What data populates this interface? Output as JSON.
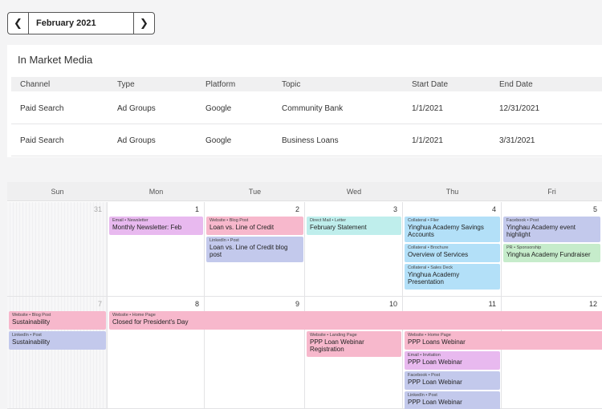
{
  "nav": {
    "prev_icon": "chevron-left-icon",
    "next_icon": "chevron-right-icon",
    "month_label": "February 2021"
  },
  "media": {
    "title": "In Market Media",
    "columns": [
      "Channel",
      "Type",
      "Platform",
      "Topic",
      "Start Date",
      "End Date"
    ],
    "rows": [
      [
        "Paid Search",
        "Ad Groups",
        "Google",
        "Community Bank",
        "1/1/2021",
        "12/31/2021"
      ],
      [
        "Paid Search",
        "Ad Groups",
        "Google",
        "Business Loans",
        "1/1/2021",
        "3/31/2021"
      ]
    ]
  },
  "calendar": {
    "weekdays": [
      "Sun",
      "Mon",
      "Tue",
      "Wed",
      "Thu",
      "Fri"
    ],
    "weeks": [
      [
        "31",
        "1",
        "2",
        "3",
        "4",
        "5"
      ],
      [
        "7",
        "8",
        "9",
        "10",
        "11",
        "12"
      ]
    ],
    "colors": {
      "pink": "#f7b8cc",
      "purple": "#e8b9ef",
      "periwinkle": "#c3c9ec",
      "cyan": "#bfeeec",
      "blue": "#b3e0f8",
      "green": "#c6eccb"
    },
    "events": [
      {
        "category": "Email • Newsletter",
        "title": "Monthly Newsletter: Feb"
      },
      {
        "category": "Website • Blog Post",
        "title": "Loan vs. Line of Credit"
      },
      {
        "category": "LinkedIn • Post",
        "title": "Loan vs. Line of Credit blog post"
      },
      {
        "category": "Direct Mail • Letter",
        "title": "February Statement"
      },
      {
        "category": "Collateral • Flier",
        "title": "Yinghua Academy Savings Accounts"
      },
      {
        "category": "Collateral • Brochure",
        "title": "Overview of Services"
      },
      {
        "category": "Collateral • Sales Deck",
        "title": "Yinghua Academy Presentation"
      },
      {
        "category": "Facebook • Post",
        "title": "Yinghau Academy event highlight"
      },
      {
        "category": "PR • Sponsorship",
        "title": "Yinghua Academy Fundraiser"
      },
      {
        "category": "Website • Blog Post",
        "title": "Sustainability"
      },
      {
        "category": "Website • Home Page",
        "title": "Closed for President's Day"
      },
      {
        "category": "LinkedIn • Post",
        "title": "Sustainability"
      },
      {
        "category": "Website • Landing Page",
        "title": "PPP Loan Webinar Registration"
      },
      {
        "category": "Website • Home Page",
        "title": "PPP Loans Webinar"
      },
      {
        "category": "Email • Invitation",
        "title": "PPP Loan Webinar"
      },
      {
        "category": "Facebook • Post",
        "title": "PPP Loan Webinar"
      },
      {
        "category": "LinkedIn • Post",
        "title": "PPP Loan Webinar"
      }
    ]
  }
}
